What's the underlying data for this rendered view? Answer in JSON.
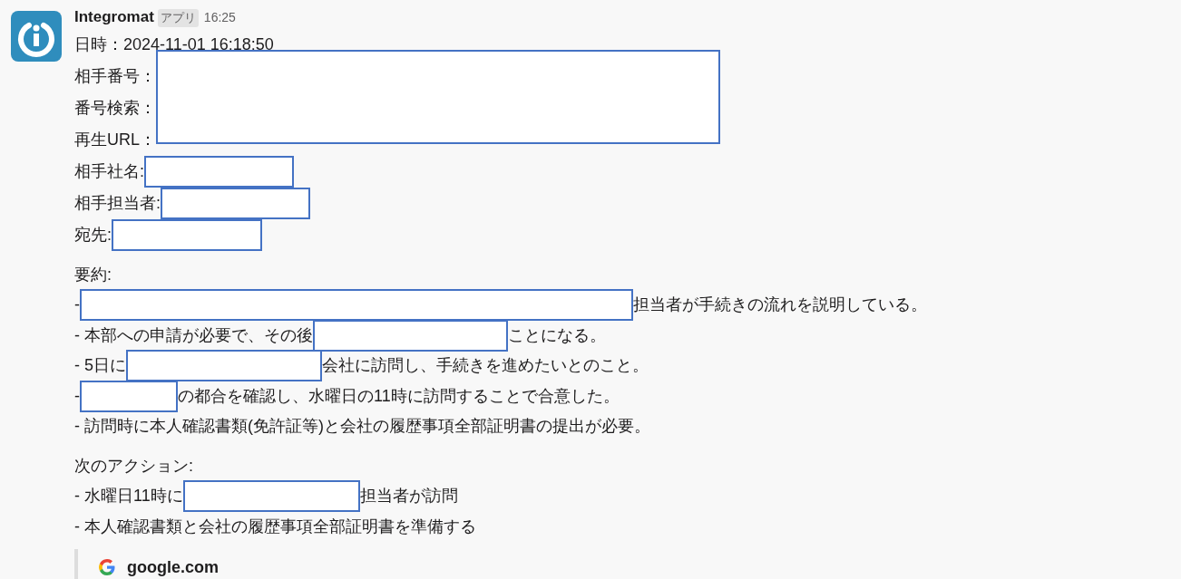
{
  "message": {
    "sender": "Integromat",
    "badge": "アプリ",
    "time": "16:25"
  },
  "fields": [
    {
      "kind": "line",
      "segments": [
        {
          "kind": "text",
          "text": "日時：2024-11-01 16:18:50"
        }
      ]
    },
    {
      "kind": "group",
      "labels": [
        "相手番号：",
        "番号検索：",
        "再生URL："
      ]
    },
    {
      "kind": "line",
      "segments": [
        {
          "kind": "text",
          "text": "相手社名:"
        },
        {
          "kind": "redacted"
        }
      ]
    },
    {
      "kind": "line",
      "segments": [
        {
          "kind": "text",
          "text": "相手担当者:"
        },
        {
          "kind": "redacted"
        }
      ]
    },
    {
      "kind": "line",
      "segments": [
        {
          "kind": "text",
          "text": "宛先:"
        },
        {
          "kind": "redacted"
        }
      ]
    }
  ],
  "summary": {
    "heading": "要約:",
    "items": [
      [
        {
          "kind": "text",
          "text": "-"
        },
        {
          "kind": "redacted"
        },
        {
          "kind": "text",
          "text": "担当者が手続きの流れを説明している。"
        }
      ],
      [
        {
          "kind": "text",
          "text": "- 本部への申請が必要で、その後"
        },
        {
          "kind": "redacted"
        },
        {
          "kind": "text",
          "text": "ことになる。"
        }
      ],
      [
        {
          "kind": "text",
          "text": "- 5日に"
        },
        {
          "kind": "redacted"
        },
        {
          "kind": "text",
          "text": "会社に訪問し、手続きを進めたいとのこと。"
        }
      ],
      [
        {
          "kind": "text",
          "text": "-"
        },
        {
          "kind": "redacted"
        },
        {
          "kind": "text",
          "text": "の都合を確認し、水曜日の11時に訪問することで合意した。"
        }
      ],
      [
        {
          "kind": "text",
          "text": "- 訪問時に本人確認書類(免許証等)と会社の履歴事項全部証明書の提出が必要。"
        }
      ]
    ]
  },
  "actions": {
    "heading": "次のアクション:",
    "items": [
      [
        {
          "kind": "text",
          "text": "- 水曜日11時に"
        },
        {
          "kind": "redacted"
        },
        {
          "kind": "text",
          "text": "担当者が訪問"
        }
      ],
      [
        {
          "kind": "text",
          "text": "- 本人確認書類と会社の履歴事項全部証明書を準備する"
        }
      ]
    ]
  },
  "link_preview": {
    "site": "google.com"
  }
}
